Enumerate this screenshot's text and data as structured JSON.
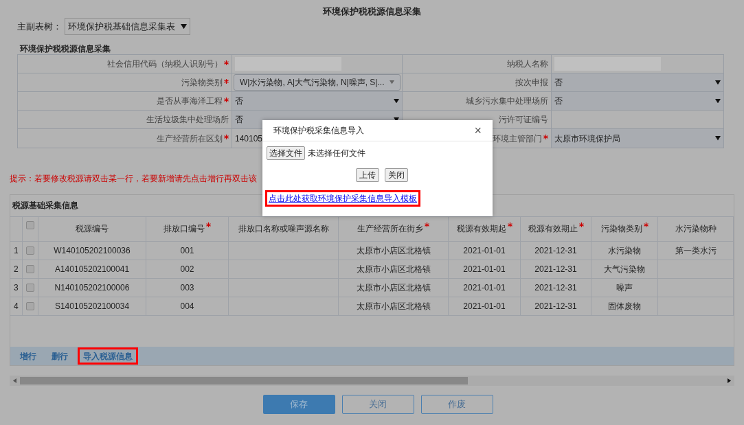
{
  "page_title": "环境保护税税源信息采集",
  "tree_selector": {
    "label": "主副表树：",
    "value": "环境保护税基础信息采集表"
  },
  "form": {
    "title": "环境保护税税源信息采集",
    "rows": [
      [
        {
          "label": "社会信用代码（纳税人识别号）",
          "required": true,
          "kind": "blank"
        },
        {
          "label": "纳税人名称",
          "required": false,
          "kind": "blank"
        }
      ],
      [
        {
          "label": "污染物类别",
          "required": true,
          "kind": "multiselect",
          "value": "W|水污染物, A|大气污染物, N|噪声, S|..."
        },
        {
          "label": "按次申报",
          "required": false,
          "kind": "select",
          "value": "否"
        }
      ],
      [
        {
          "label": "是否从事海洋工程",
          "required": true,
          "kind": "select",
          "value": "否"
        },
        {
          "label": "城乡污水集中处理场所",
          "required": false,
          "kind": "select",
          "value": "否"
        }
      ],
      [
        {
          "label": "生活垃圾集中处理场所",
          "required": false,
          "kind": "select",
          "value": "否"
        },
        {
          "label": "污许可证编号",
          "required": false,
          "kind": "text"
        }
      ],
      [
        {
          "label": "生产经营所在区划",
          "required": true,
          "kind": "text",
          "value": "140105"
        },
        {
          "label": "环境主管部门",
          "required": true,
          "kind": "select",
          "value": "太原市环境保护局"
        }
      ]
    ]
  },
  "hint": "提示：若要修改税源请双击某一行，若要新增请先点击增行再双击该",
  "grid": {
    "title": "税源基础采集信息",
    "all_checked": false,
    "columns": [
      {
        "label": "税源编号",
        "required": false
      },
      {
        "label": "排放口编号",
        "required": true
      },
      {
        "label": "排放口名称或噪声源名称",
        "required": false
      },
      {
        "label": "生产经营所在街乡",
        "required": true
      },
      {
        "label": "税源有效期起",
        "required": true
      },
      {
        "label": "税源有效期止",
        "required": true
      },
      {
        "label": "污染物类别",
        "required": true
      },
      {
        "label": "水污染物种",
        "required": false
      }
    ],
    "rows": [
      {
        "index": "1",
        "checked": false,
        "cells": [
          "W140105202100036",
          "001",
          "",
          "太原市小店区北格镇",
          "2021-01-01",
          "2021-12-31",
          "水污染物",
          "第一类水污"
        ]
      },
      {
        "index": "2",
        "checked": false,
        "cells": [
          "A140105202100041",
          "002",
          "",
          "太原市小店区北格镇",
          "2021-01-01",
          "2021-12-31",
          "大气污染物",
          ""
        ]
      },
      {
        "index": "3",
        "checked": false,
        "cells": [
          "N140105202100006",
          "003",
          "",
          "太原市小店区北格镇",
          "2021-01-01",
          "2021-12-31",
          "噪声",
          ""
        ]
      },
      {
        "index": "4",
        "checked": false,
        "cells": [
          "S140105202100034",
          "004",
          "",
          "太原市小店区北格镇",
          "2021-01-01",
          "2021-12-31",
          "固体废物",
          ""
        ]
      }
    ],
    "toolbar": [
      {
        "label": "增行",
        "highlighted": false
      },
      {
        "label": "删行",
        "highlighted": false
      },
      {
        "label": "导入税源信息",
        "highlighted": true
      }
    ]
  },
  "footer_buttons": [
    {
      "label": "保存",
      "kind": "primary"
    },
    {
      "label": "关闭",
      "kind": "default"
    },
    {
      "label": "作废",
      "kind": "default"
    }
  ],
  "dialog": {
    "title": "环境保护税采集信息导入",
    "close": "×",
    "file_button": "选择文件",
    "file_status": "未选择任何文件",
    "buttons": [
      "上传",
      "关闭"
    ],
    "link": {
      "label": "点击此处获取环境保护采集信息导入模板",
      "highlighted": true
    }
  }
}
